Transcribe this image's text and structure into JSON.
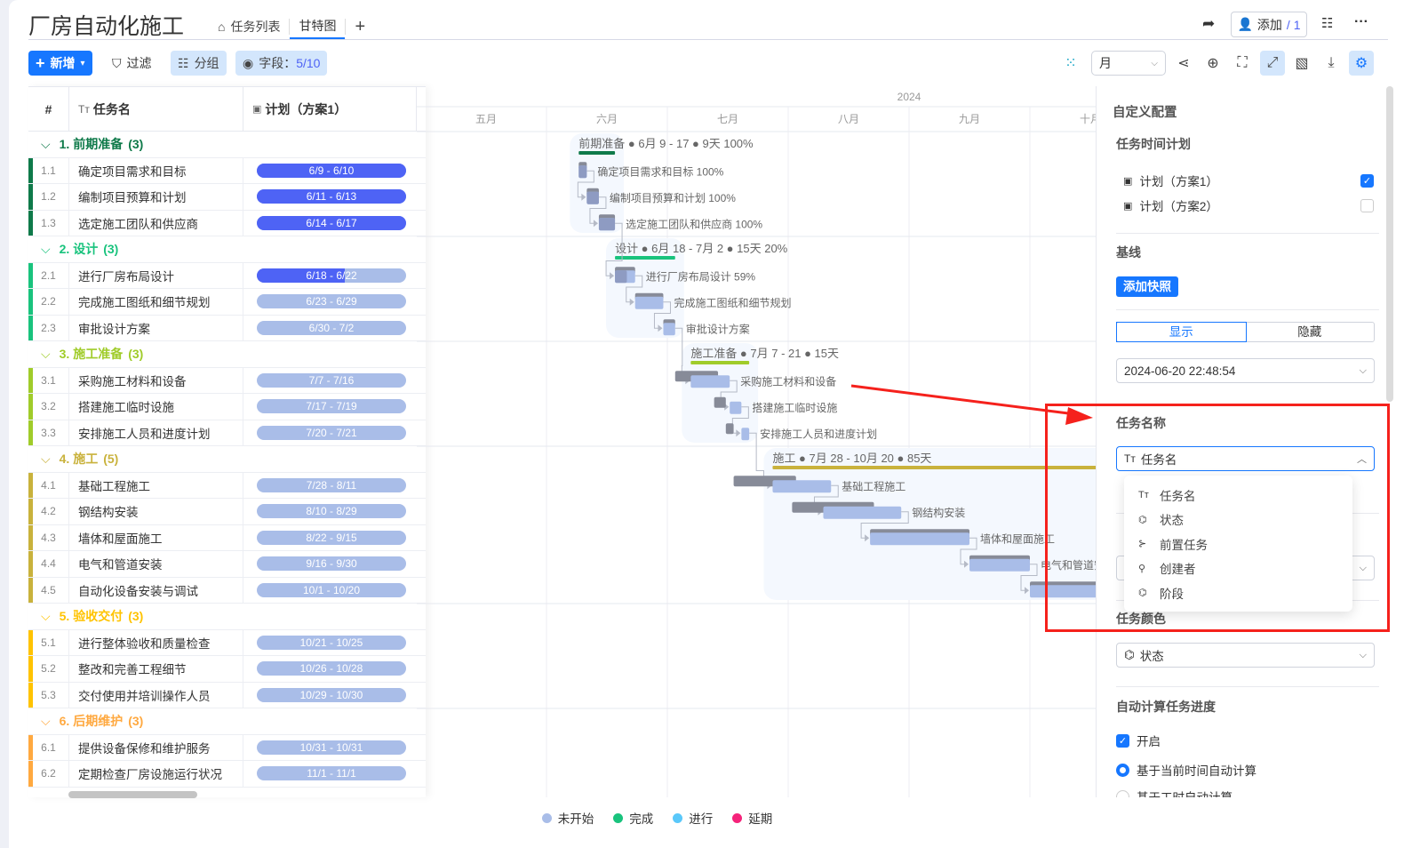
{
  "header": {
    "title": "厂房自动化施工",
    "tabs": [
      {
        "label": "任务列表",
        "icon": "home-icon"
      },
      {
        "label": "甘特图",
        "active": true
      }
    ],
    "add_tab": "+",
    "share_icon": "share-icon",
    "add_member": "添加",
    "member_count": "/ 1",
    "more": "···"
  },
  "toolbar": {
    "new_label": "新增",
    "filter_label": "过滤",
    "group_label": "分组",
    "fields_label": "字段：",
    "fields_value": "5/10",
    "scale_value": "月"
  },
  "table": {
    "col_num": "#",
    "col_name": "任务名",
    "col_plan": "计划（方案1）"
  },
  "colors": {
    "done": "#4e63f5",
    "todo": "#a9bde8",
    "accent": "#1677ff"
  },
  "groups": [
    {
      "label": "1. 前期准备",
      "count": "(3)",
      "color": "#0f7a4a",
      "summary": {
        "name": "前期准备",
        "range": "6月 9 - 17",
        "days": "9天",
        "progress": "100%"
      },
      "tasks": [
        {
          "num": "1.1",
          "name": "确定项目需求和目标",
          "plan": "6/9 - 6/10",
          "progress": 100,
          "show_progress": "100%"
        },
        {
          "num": "1.2",
          "name": "编制项目预算和计划",
          "plan": "6/11 - 6/13",
          "progress": 100,
          "show_progress": "100%"
        },
        {
          "num": "1.3",
          "name": "选定施工团队和供应商",
          "plan": "6/14 - 6/17",
          "progress": 100,
          "show_progress": "100%"
        }
      ]
    },
    {
      "label": "2. 设计",
      "count": "(3)",
      "color": "#19c37d",
      "summary": {
        "name": "设计",
        "range": "6月 18 - 7月 2",
        "days": "15天",
        "progress": "20%"
      },
      "tasks": [
        {
          "num": "2.1",
          "name": "进行厂房布局设计",
          "plan": "6/18 - 6/22",
          "progress": 59,
          "show_progress": "59%"
        },
        {
          "num": "2.2",
          "name": "完成施工图纸和细节规划",
          "plan": "6/23 - 6/29",
          "progress": 0
        },
        {
          "num": "2.3",
          "name": "审批设计方案",
          "plan": "6/30 - 7/2",
          "progress": 0
        }
      ]
    },
    {
      "label": "3. 施工准备",
      "count": "(3)",
      "color": "#a0cc2a",
      "summary": {
        "name": "施工准备",
        "range": "7月 7 - 21",
        "days": "15天",
        "progress": ""
      },
      "tasks": [
        {
          "num": "3.1",
          "name": "采购施工材料和设备",
          "plan": "7/7 - 7/16",
          "progress": 0,
          "baseline": "7/3 - 7/13"
        },
        {
          "num": "3.2",
          "name": "搭建施工临时设施",
          "plan": "7/17 - 7/19",
          "progress": 0,
          "baseline": "7/13 - 7/15"
        },
        {
          "num": "3.3",
          "name": "安排施工人员和进度计划",
          "plan": "7/20 - 7/21",
          "progress": 0,
          "baseline": "7/16 - 7/17"
        }
      ]
    },
    {
      "label": "4. 施工",
      "count": "(5)",
      "color": "#c9b23c",
      "summary": {
        "name": "施工",
        "range": "7月 28 - 10月 20",
        "days": "85天",
        "progress": ""
      },
      "tasks": [
        {
          "num": "4.1",
          "name": "基础工程施工",
          "plan": "7/28 - 8/11",
          "progress": 0,
          "baseline": "7/18 - 8/2"
        },
        {
          "num": "4.2",
          "name": "钢结构安装",
          "plan": "8/10 - 8/29",
          "progress": 0,
          "baseline": "8/2 - 8/22"
        },
        {
          "num": "4.3",
          "name": "墙体和屋面施工",
          "plan": "8/22 - 9/15",
          "progress": 0
        },
        {
          "num": "4.4",
          "name": "电气和管道安装",
          "plan": "9/16 - 9/30",
          "progress": 0
        },
        {
          "num": "4.5",
          "name": "自动化设备安装与调试",
          "plan": "10/1 - 10/20",
          "progress": 0
        }
      ]
    },
    {
      "label": "5. 验收交付",
      "count": "(3)",
      "color": "#ffc300",
      "summary": null,
      "tasks": [
        {
          "num": "5.1",
          "name": "进行整体验收和质量检查",
          "plan": "10/21 - 10/25",
          "progress": 0
        },
        {
          "num": "5.2",
          "name": "整改和完善工程细节",
          "plan": "10/26 - 10/28",
          "progress": 0
        },
        {
          "num": "5.3",
          "name": "交付使用并培训操作人员",
          "plan": "10/29 - 10/30",
          "progress": 0
        }
      ]
    },
    {
      "label": "6. 后期维护",
      "count": "(3)",
      "color": "#ffa940",
      "summary": null,
      "tasks": [
        {
          "num": "6.1",
          "name": "提供设备保修和维护服务",
          "plan": "10/31 - 10/31",
          "progress": 0
        },
        {
          "num": "6.2",
          "name": "定期检查厂房设施运行状况",
          "plan": "11/1 - 11/1",
          "progress": 0
        }
      ]
    }
  ],
  "timeline": {
    "year": "2024",
    "months": [
      "五月",
      "六月",
      "七月",
      "八月",
      "九月",
      "十月"
    ]
  },
  "panel": {
    "title": "自定义配置",
    "time_plan": {
      "heading": "任务时间计划",
      "items": [
        {
          "label": "计划（方案1）",
          "checked": true
        },
        {
          "label": "计划（方案2）",
          "checked": false
        }
      ]
    },
    "baseline": {
      "heading": "基线",
      "add_snapshot": "添加快照",
      "show": "显示",
      "hide": "隐藏",
      "snapshot": "2024-06-20 22:48:54"
    },
    "task_name": {
      "heading": "任务名称",
      "value": "任务名",
      "options": [
        {
          "label": "任务名",
          "icon": "text-type-icon"
        },
        {
          "label": "状态",
          "icon": "tag-icon"
        },
        {
          "label": "前置任务",
          "icon": "dependency-icon"
        },
        {
          "label": "创建者",
          "icon": "user-icon"
        },
        {
          "label": "阶段",
          "icon": "tag-icon"
        }
      ]
    },
    "task_color": {
      "heading": "任务颜色",
      "value": "状态"
    },
    "auto_progress": {
      "heading": "自动计算任务进度",
      "enable": "开启",
      "opt1": "基于当前时间自动计算",
      "opt2": "基于工时自动计算"
    }
  },
  "legend": [
    {
      "label": "未开始",
      "color": "#a9bde8"
    },
    {
      "label": "完成",
      "color": "#19c37d"
    },
    {
      "label": "进行",
      "color": "#5ac8fa"
    },
    {
      "label": "延期",
      "color": "#f5237a"
    }
  ]
}
